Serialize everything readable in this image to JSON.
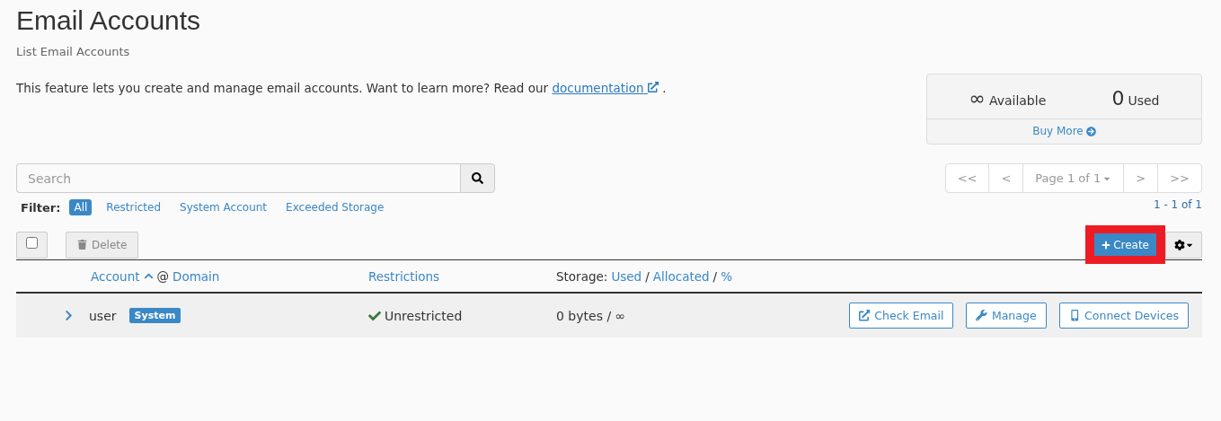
{
  "page": {
    "title": "Email Accounts",
    "subtitle": "List Email Accounts"
  },
  "intro": {
    "text": "This feature lets you create and manage email accounts. Want to learn more? Read our",
    "link": "documentation",
    "end": "."
  },
  "stats": {
    "available_value": "∞",
    "available_label": "Available",
    "used_value": "0",
    "used_label": "Used",
    "buy_more": "Buy More"
  },
  "search": {
    "placeholder": "Search"
  },
  "pagination": {
    "first": "<<",
    "prev": "<",
    "page": "Page 1 of 1",
    "next": ">",
    "last": ">>",
    "range": "1 - 1 of 1"
  },
  "filter": {
    "label": "Filter:",
    "options": [
      {
        "label": "All",
        "selected": true
      },
      {
        "label": "Restricted",
        "selected": false
      },
      {
        "label": "System Account",
        "selected": false
      },
      {
        "label": "Exceeded Storage",
        "selected": false
      }
    ]
  },
  "toolbar": {
    "select_all_checked": false,
    "delete": "Delete",
    "delete_disabled": true,
    "create": "Create",
    "create_highlighted": true
  },
  "table": {
    "columns": {
      "account": "Account",
      "at": "@",
      "domain": "Domain",
      "restrictions": "Restrictions",
      "storage": "Storage:",
      "used": "Used",
      "sep1": "/",
      "allocated": "Allocated",
      "sep2": "/",
      "percent": "%"
    },
    "rows": [
      {
        "account": "user",
        "badge": "System",
        "restriction": "Unrestricted",
        "storage": "0 bytes / ∞",
        "expanded": false,
        "actions": [
          "Check Email",
          "Manage",
          "Connect Devices"
        ]
      }
    ]
  }
}
